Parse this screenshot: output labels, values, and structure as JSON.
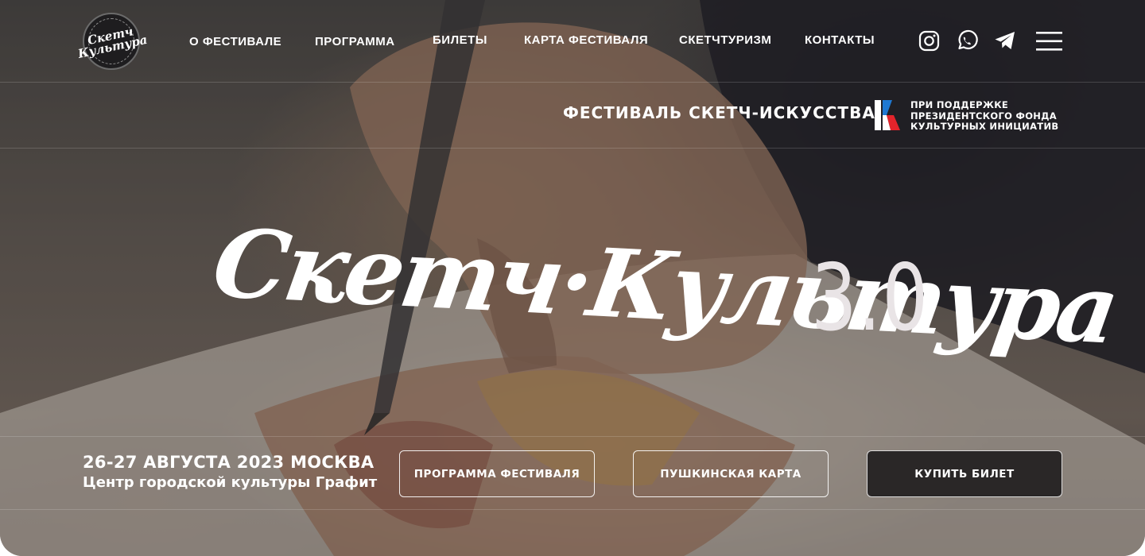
{
  "header": {
    "logo_text": "Скетч Культура",
    "nav": [
      {
        "label": "О ФЕСТИВАЛЕ"
      },
      {
        "label": "ПРОГРАММА"
      },
      {
        "label": "БИЛЕТЫ"
      },
      {
        "label": "КАРТА ФЕСТИВАЛЯ"
      },
      {
        "label": "СКЕТЧТУРИЗМ"
      },
      {
        "label": "КОНТАКТЫ"
      }
    ],
    "social_icons": [
      "instagram-icon",
      "whatsapp-icon",
      "telegram-icon"
    ],
    "menu_icon": "hamburger-menu-icon"
  },
  "subheader": {
    "title": "ФЕСТИВАЛЬ СКЕТЧ-ИСКУССТВА",
    "sponsor_lines": [
      "ПРИ ПОДДЕРЖКЕ",
      "ПРЕЗИДЕНТСКОГО ФОНДА",
      "КУЛЬТУРНЫХ ИНИЦИАТИВ"
    ]
  },
  "hero": {
    "title": "Скетч·Культура",
    "version": "3.0"
  },
  "event": {
    "date": "26-27 АВГУСТА 2023  МОСКВА",
    "venue": "Центр городской культуры Графит"
  },
  "buttons": {
    "program": "ПРОГРАММА ФЕСТИВАЛЯ",
    "pushkin": "ПУШКИНСКАЯ КАРТА",
    "buy": "КУПИТЬ БИЛЕТ"
  },
  "colors": {
    "accent_blue": "#1f78d1",
    "accent_red": "#e3242b",
    "button_dark": "#2a2727"
  }
}
